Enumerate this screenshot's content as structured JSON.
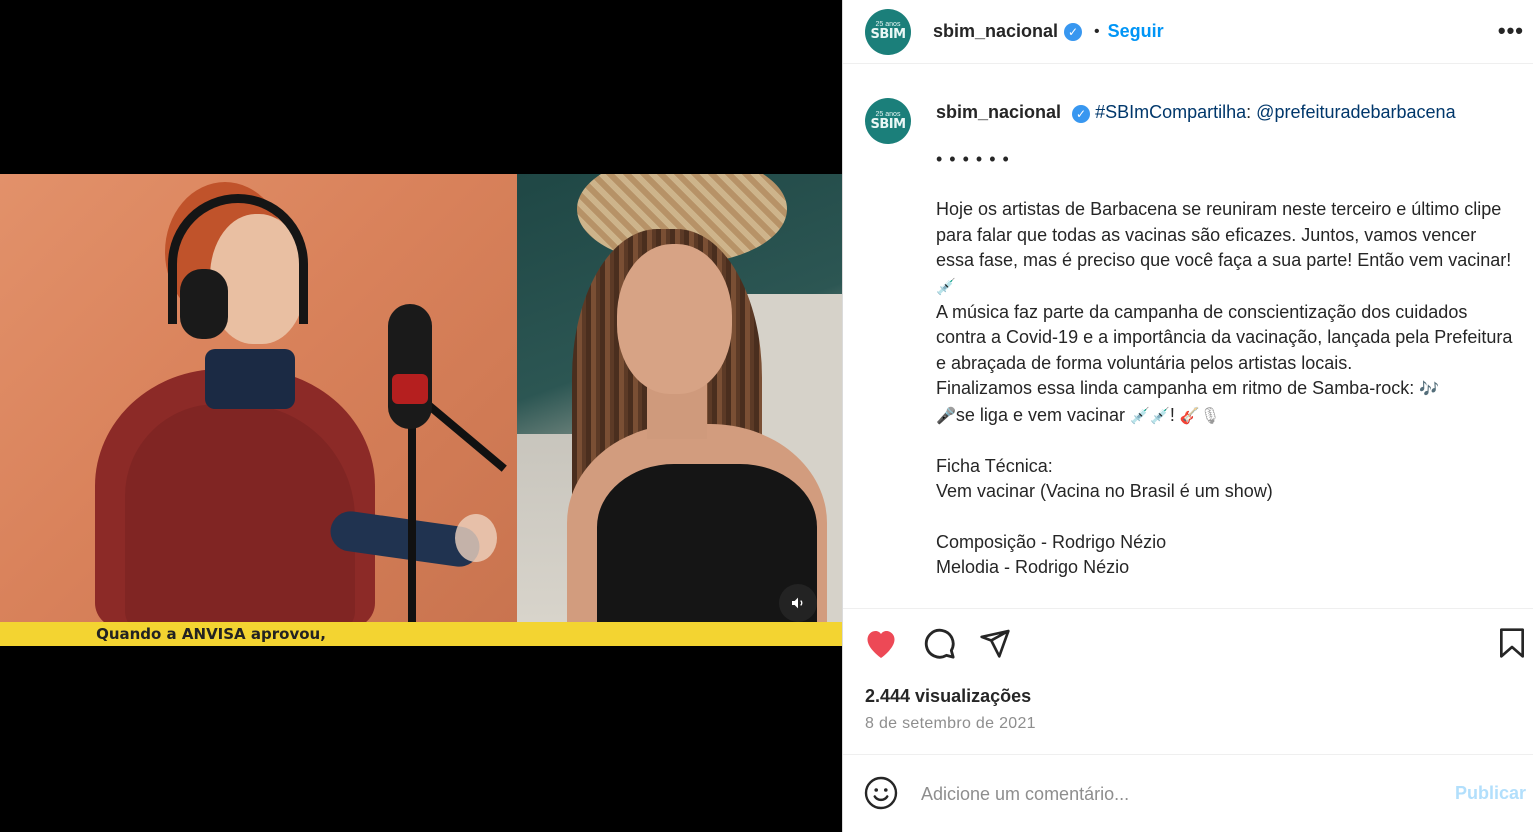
{
  "video": {
    "subtitle": "Quando a ANVISA aprovou,"
  },
  "header": {
    "username": "sbim_nacional",
    "separator": "•",
    "follow_label": "Seguir",
    "more_label": "•••"
  },
  "avatar": {
    "small_text": "25 anos",
    "main_text": "SBIM"
  },
  "caption": {
    "username": "sbim_nacional",
    "hashtag": "#SBImCompartilha",
    "separator": ":",
    "mention": "@prefeituradebarbacena",
    "dots": "• • • • • •",
    "paragraph1": "Hoje os artistas de Barbacena se reuniram neste terceiro e último clipe para falar que todas as vacinas são eficazes. Juntos, vamos vencer essa fase, mas é preciso que você faça a sua parte! Então vem vacinar!",
    "paragraph2": "A música faz parte da campanha de conscientização dos cuidados contra a Covid-19 e a importância da vacinação, lançada pela Prefeitura e abraçada de forma voluntária pelos artistas locais.",
    "paragraph3a": "Finalizamos essa linda campanha em ritmo de Samba-rock:",
    "paragraph3b": "se liga e vem vacinar",
    "paragraph3c": "!",
    "ficha_title": "Ficha Técnica:",
    "ficha_song": "Vem vacinar (Vacina no Brasil é um show)",
    "composicao": "Composição - Rodrigo Nézio",
    "melodia": "Melodia - Rodrigo Nézio"
  },
  "stats": {
    "views": "2.444 visualizações",
    "date": "8 de setembro de 2021"
  },
  "comment": {
    "placeholder": "Adicione um comentário...",
    "publish_label": "Publicar"
  },
  "icons": {
    "like": "heart-icon",
    "comment": "comment-icon",
    "share": "send-icon",
    "save": "bookmark-icon",
    "emoji": "smiley-icon",
    "mute": "speaker-icon",
    "verified": "verified-badge-icon"
  },
  "colors": {
    "like": "#ed4956",
    "link": "#00376b",
    "follow": "#0095f6",
    "verified": "#3897f0",
    "subtitle_bar": "#f3d431",
    "publish_disabled": "#b2dffc"
  }
}
